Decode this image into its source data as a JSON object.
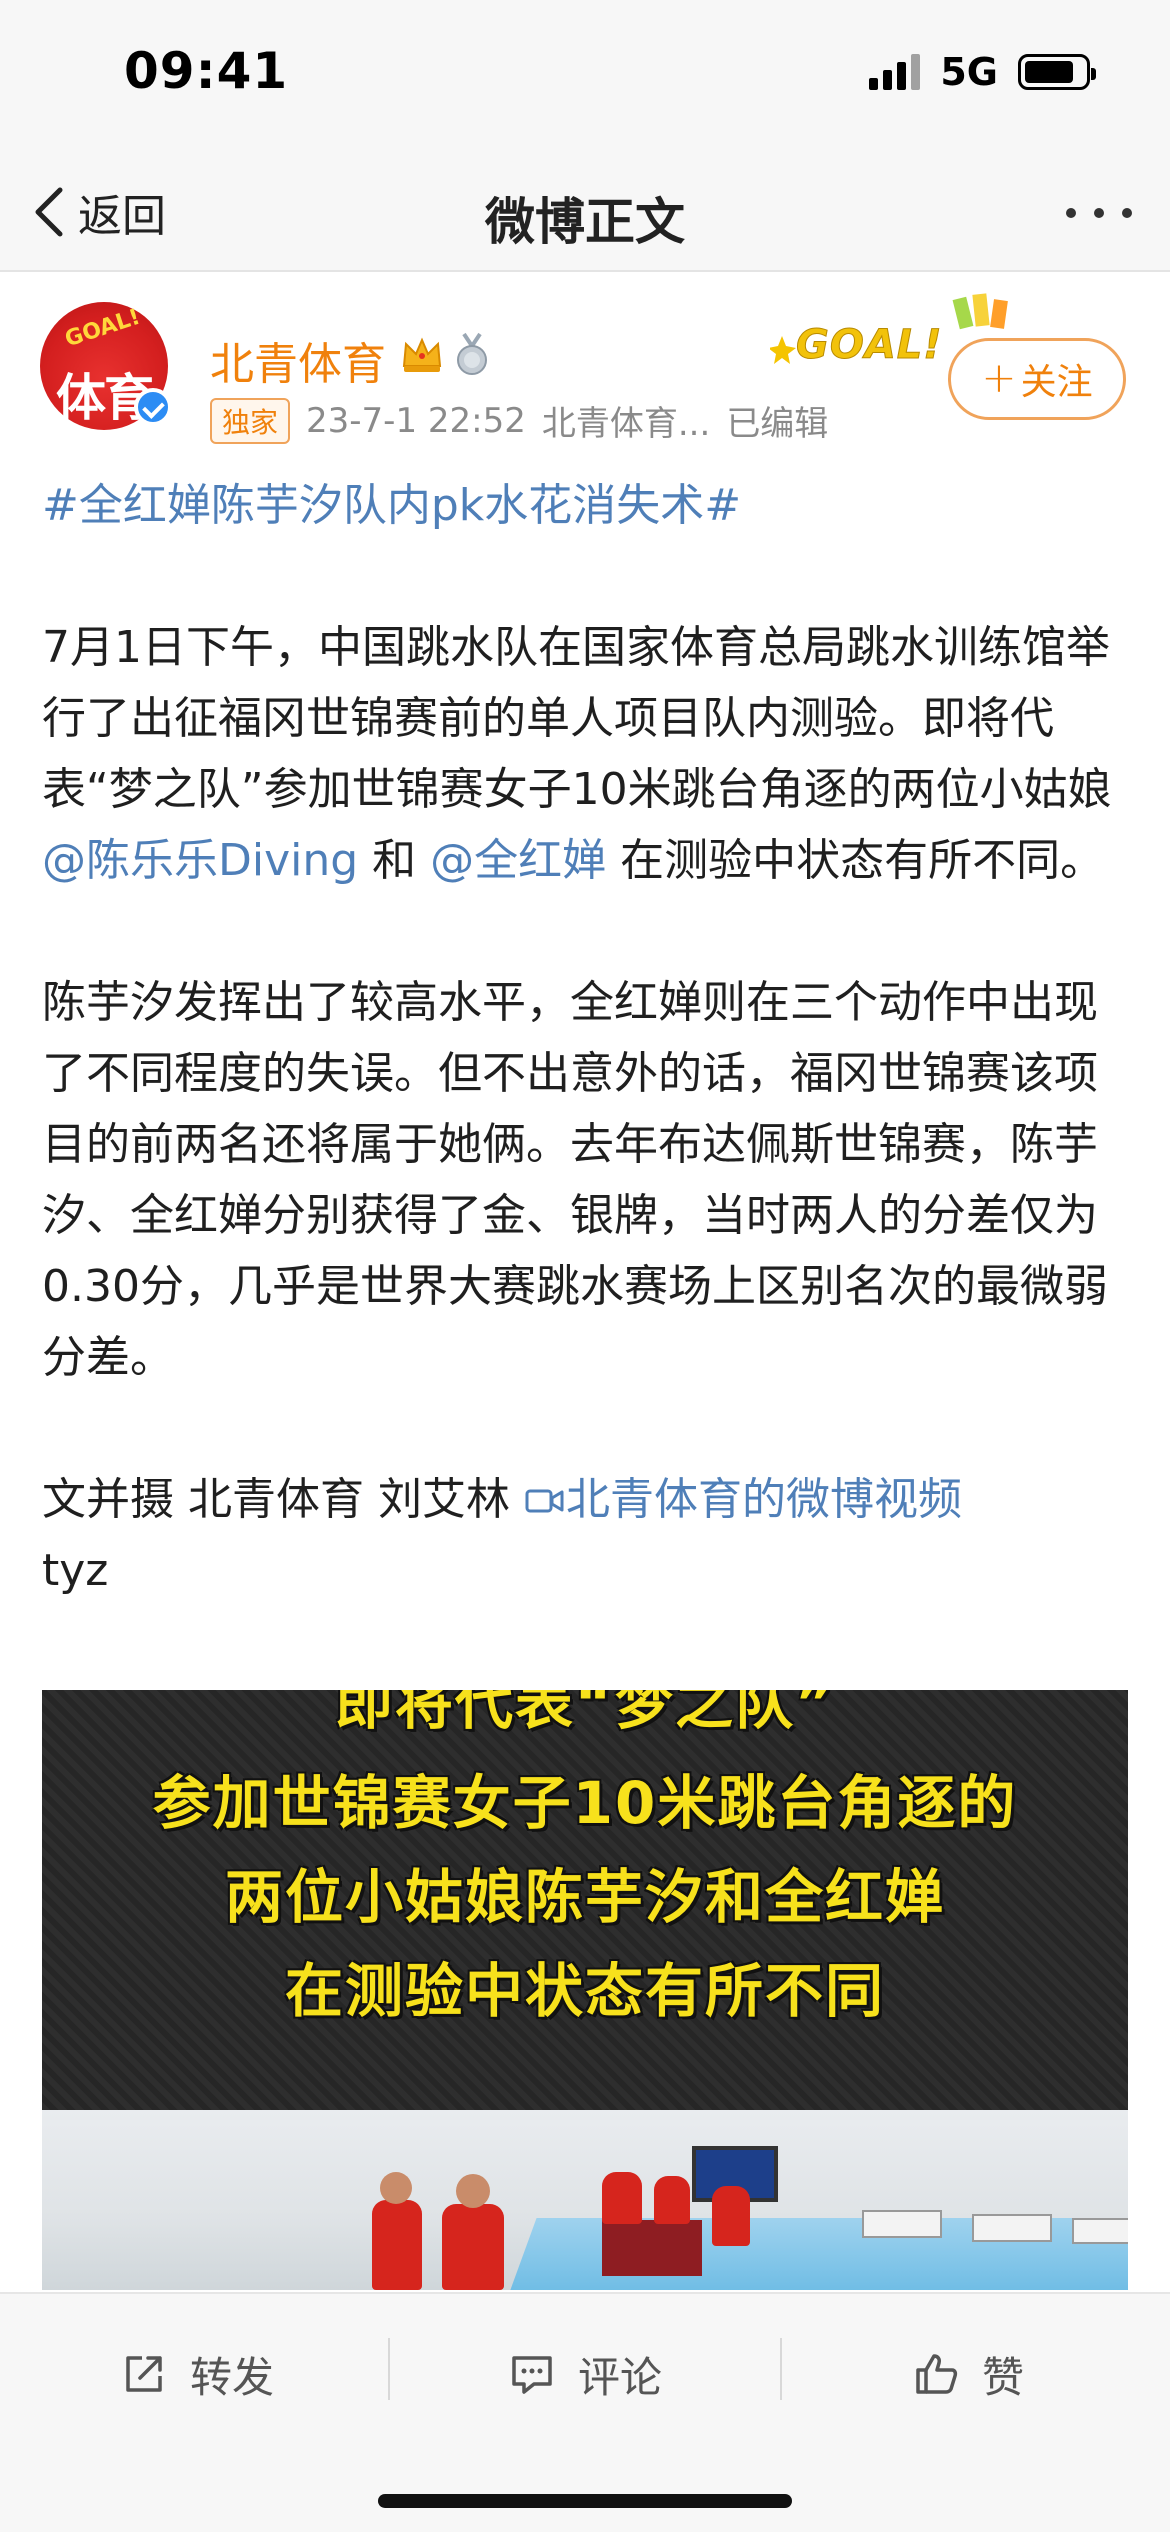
{
  "status_bar": {
    "time": "09:41",
    "network": "5G",
    "battery_level": 0.82
  },
  "nav": {
    "back_label": "返回",
    "title": "微博正文"
  },
  "post": {
    "author": {
      "name": "北青体育",
      "avatar_text": "体育",
      "avatar_goal_text": "GOAL!"
    },
    "badge": "独家",
    "timestamp": "23-7-1 22:52",
    "source": "北青体育...",
    "edited": "已编辑",
    "header_deco_text": "GOAL!",
    "follow_label": "关注",
    "follow_plus": "+",
    "topic": "#全红婵陈芋汐队内pk水花消失术#",
    "p1_part1": "7月1日下午，中国跳水队在国家体育总局跳水训练馆举行了出征福冈世锦赛前的单人项目队内测验。即将代表“梦之队”参加世锦赛女子10米跳台角逐的两位小姑娘",
    "mention1": "@陈乐乐Diving",
    "p1_and": " 和 ",
    "mention2": "@全红婵",
    "p1_part2": " 在测验中状态有所不同。",
    "p2": "陈芋汐发挥出了较高水平，全红婵则在三个动作中出现了不同程度的失误。但不出意外的话，福冈世锦赛该项目的前两名还将属于她俩。去年布达佩斯世锦赛，陈芋汐、全红婵分别获得了金、银牌，当时两人的分差仅为0.30分，几乎是世界大赛跳水赛场上区别名次的最微弱分差。",
    "p3_text": "文并摄 北青体育 刘艾林 ",
    "video_link": "北青体育的微博视频",
    "p3_suffix": "tyz",
    "video": {
      "captions": [
        "即将代表“梦之队”",
        "参加世锦赛女子10米跳台角逐的",
        "两位小姑娘陈芋汐和全红婵",
        "在测验中状态有所不同"
      ]
    }
  },
  "actions": {
    "repost": "转发",
    "comment": "评论",
    "like": "赞"
  },
  "colors": {
    "accent_orange": "#f0810c",
    "link_blue": "#4f7fb8",
    "caption_yellow": "#f7e11c"
  }
}
